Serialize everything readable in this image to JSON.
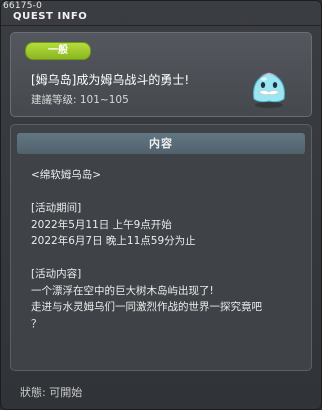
{
  "window": {
    "id": "66175-0",
    "title": "QUEST INFO"
  },
  "quest": {
    "category": "一般",
    "name": "[姆乌岛]成为姆乌战斗的勇士!",
    "level": "建議等级: 101~105",
    "mascot_icon": "slime-mascot-icon"
  },
  "content": {
    "header": "内容",
    "intro": "<绵软姆乌岛>",
    "period_label": "[活动期间]",
    "period_start": "2022年5月11日 上午9点开始",
    "period_end": "2022年6月7日 晚上11点59分为止",
    "details_label": "[活动内容]",
    "details_line1": "一个漂浮在空中的巨大树木岛屿出现了!",
    "details_line2": "走进与水灵姆乌们一同激烈作战的世界一探究竟吧",
    "details_line3": "？"
  },
  "status": "狀態: 可開始",
  "colors": {
    "badge": "#9cc82a",
    "header": "#58707c",
    "panel": "#4c5055"
  }
}
